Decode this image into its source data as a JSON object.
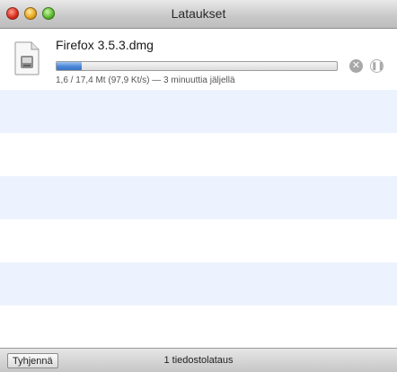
{
  "window": {
    "title": "Lataukset"
  },
  "downloads": [
    {
      "file_name": "Firefox 3.5.3.dmg",
      "status": "1,6 / 17,4 Mt (97,9 Kt/s) — 3 minuuttia jäljellä",
      "progress": 0.09,
      "icon": "disk-image-file-icon"
    }
  ],
  "footer": {
    "clear_label": "Tyhjennä",
    "count_text": "1 tiedostolataus"
  },
  "colors": {
    "stripe": "#edf3fe",
    "progress": "#4a86d8"
  }
}
